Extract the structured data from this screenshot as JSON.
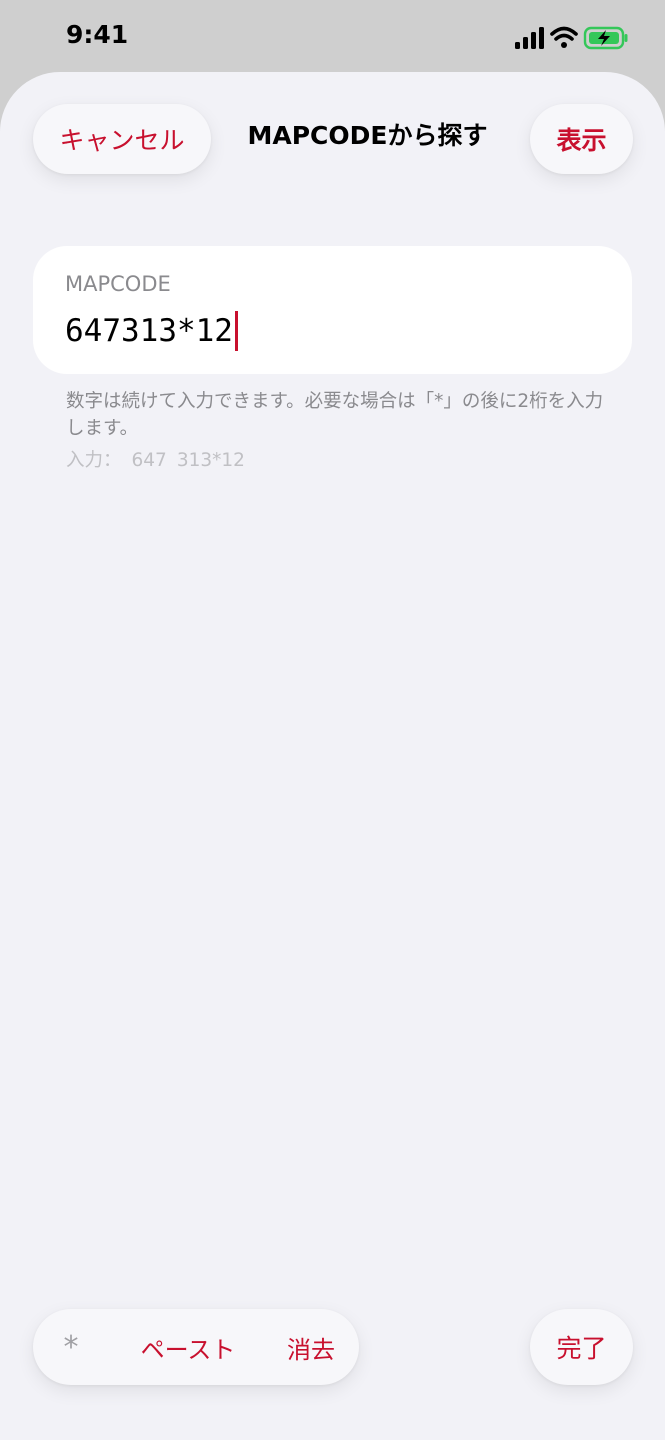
{
  "status_bar": {
    "time": "9:41",
    "battery_color": "#34c759"
  },
  "header": {
    "cancel_label": "キャンセル",
    "title": "MAPCODEから探す",
    "show_label": "表示"
  },
  "field": {
    "label": "MAPCODE",
    "value": "647313*12"
  },
  "hint": {
    "text": "数字は続けて入力できます。必要な場合は「*」の後に2桁を入力します。",
    "input_prefix": "入力：",
    "input_part1": "647",
    "input_part2": "313*12"
  },
  "toolbar": {
    "asterisk_label": "*",
    "paste_label": "ペースト",
    "clear_label": "消去",
    "done_label": "完了"
  },
  "colors": {
    "accent": "#c8102e",
    "background": "#f2f2f7"
  }
}
